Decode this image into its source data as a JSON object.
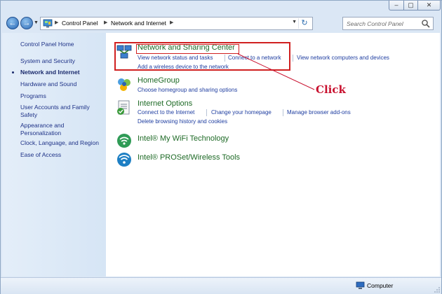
{
  "window": {
    "controls": {
      "minimize": "–",
      "maximize": "▢",
      "close": "✕"
    }
  },
  "nav": {
    "back_icon": "back-arrow-icon",
    "forward_icon": "forward-arrow-icon",
    "breadcrumbs": [
      "Control Panel",
      "Network and Internet"
    ],
    "search_placeholder": "Search Control Panel"
  },
  "sidebar": {
    "items": [
      {
        "label": "Control Panel Home",
        "active": false
      },
      {
        "label": "System and Security",
        "active": false
      },
      {
        "label": "Network and Internet",
        "active": true
      },
      {
        "label": "Hardware and Sound",
        "active": false
      },
      {
        "label": "Programs",
        "active": false
      },
      {
        "label": "User Accounts and Family Safety",
        "active": false
      },
      {
        "label": "Appearance and Personalization",
        "active": false
      },
      {
        "label": "Clock, Language, and Region",
        "active": false
      },
      {
        "label": "Ease of Access",
        "active": false
      }
    ]
  },
  "categories": [
    {
      "title": "Network and Sharing Center",
      "icon": "network-sharing-icon",
      "links": [
        "View network status and tasks",
        "Connect to a network",
        "View network computers and devices",
        "Add a wireless device to the network"
      ]
    },
    {
      "title": "HomeGroup",
      "icon": "homegroup-icon",
      "links": [
        "Choose homegroup and sharing options"
      ]
    },
    {
      "title": "Internet Options",
      "icon": "internet-options-icon",
      "links": [
        "Connect to the Internet",
        "Change your homepage",
        "Manage browser add-ons",
        "Delete browsing history and cookies"
      ]
    },
    {
      "title": "Intel® My WiFi Technology",
      "icon": "intel-wifi-icon",
      "links": []
    },
    {
      "title": "Intel® PROSet/Wireless Tools",
      "icon": "intel-proset-wireless-icon",
      "links": []
    }
  ],
  "annotation": {
    "text": "Click",
    "color": "#c8102e"
  },
  "status": {
    "text": "Computer"
  }
}
